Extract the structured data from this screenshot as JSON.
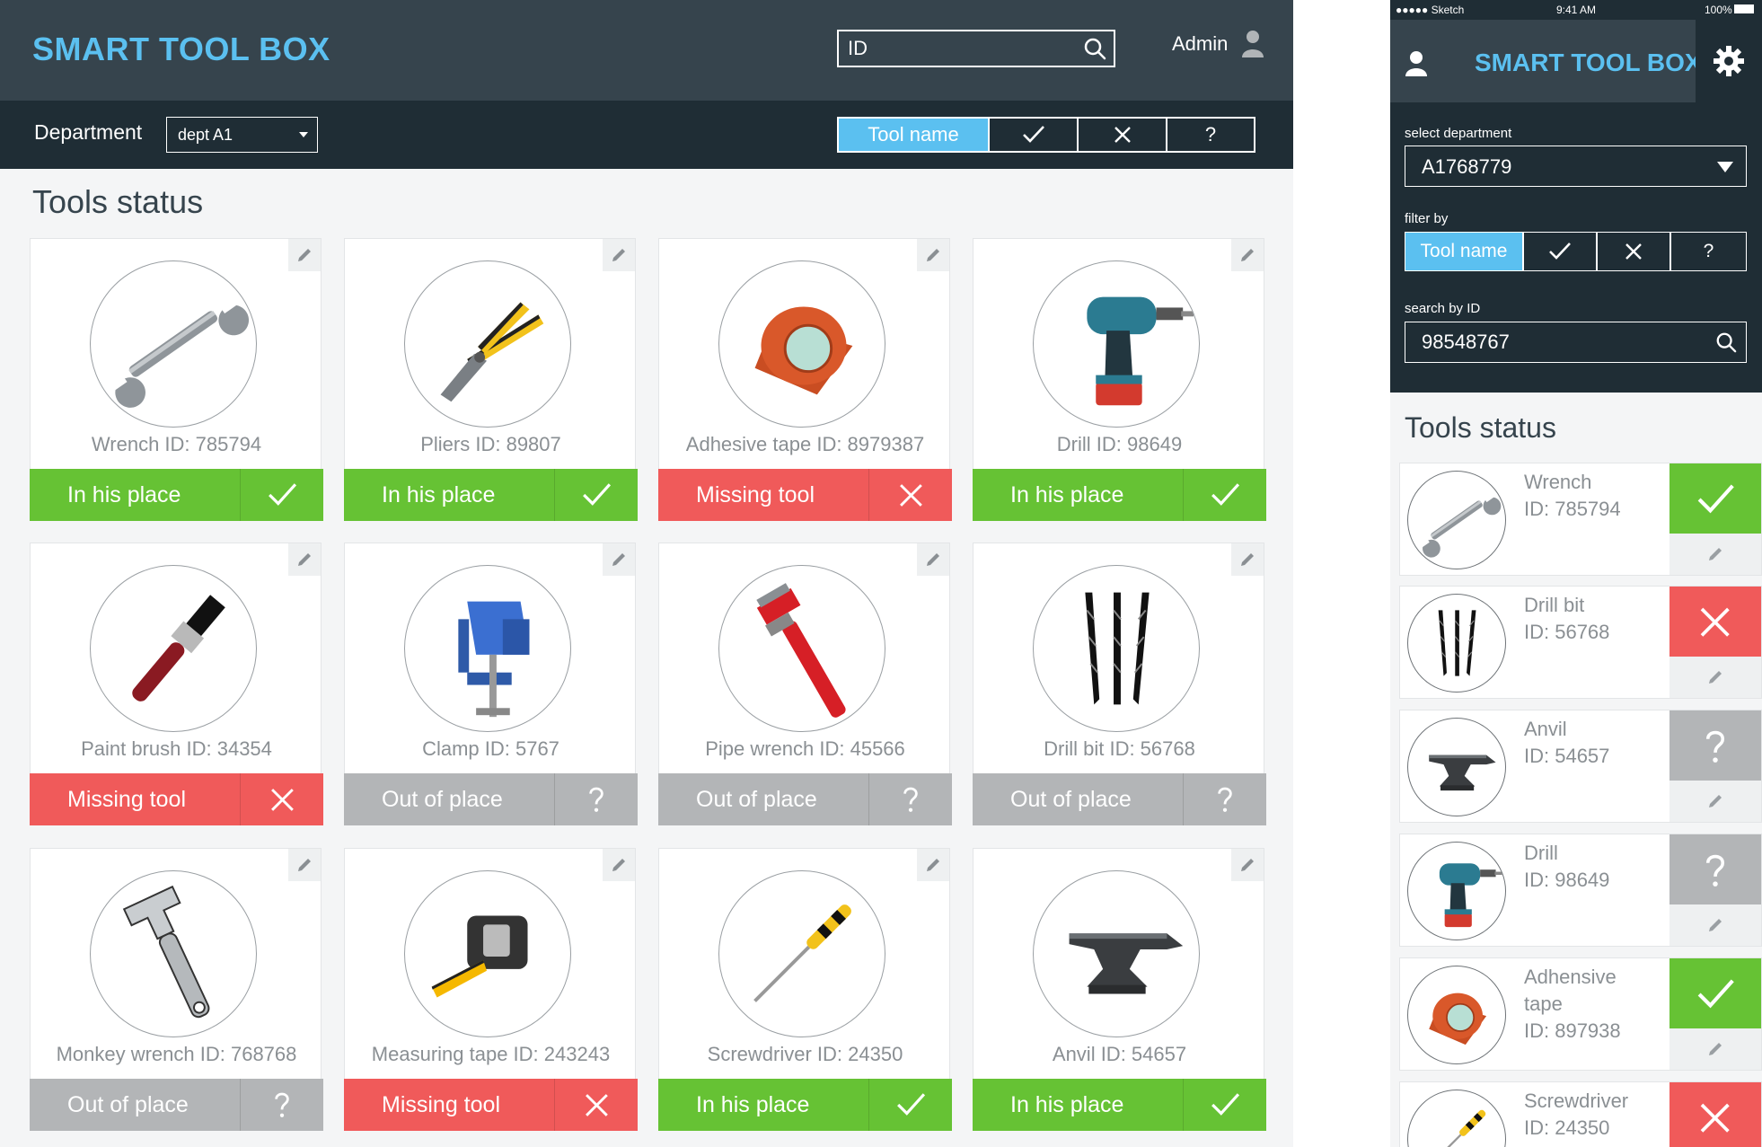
{
  "desktop": {
    "brand": "SMART TOOL BOX",
    "search_placeholder": "ID",
    "admin_label": "Admin",
    "department_label": "Department",
    "department_value": "dept A1",
    "filter": {
      "tool_name": "Tool name",
      "in_place_symbol": "✓",
      "missing_symbol": "✕",
      "out_symbol": "?"
    },
    "section_title": "Tools status",
    "tools": [
      {
        "name": "Wrench ID: 785794",
        "status": "In his place",
        "status_icon": "check-icon",
        "color": "#66c234"
      },
      {
        "name": "Pliers ID: 89807",
        "status": "In his place",
        "status_icon": "check-icon",
        "color": "#66c234"
      },
      {
        "name": "Adhesive tape ID: 8979387",
        "status": "Missing tool",
        "status_icon": "x-icon",
        "color": "#f05a5a"
      },
      {
        "name": "Drill ID: 98649",
        "status": "In his place",
        "status_icon": "check-icon",
        "color": "#66c234"
      },
      {
        "name": "Paint brush ID: 34354",
        "status": "Missing tool",
        "status_icon": "x-icon",
        "color": "#f05a5a"
      },
      {
        "name": "Clamp ID: 5767",
        "status": "Out of place",
        "status_icon": "question-icon",
        "color": "#b3b5b7"
      },
      {
        "name": "Pipe wrench ID: 45566",
        "status": "Out of place",
        "status_icon": "question-icon",
        "color": "#b3b5b7"
      },
      {
        "name": "Drill bit ID: 56768",
        "status": "Out of place",
        "status_icon": "question-icon",
        "color": "#b3b5b7"
      },
      {
        "name": "Monkey wrench ID: 768768",
        "status": "Out of place",
        "status_icon": "question-icon",
        "color": "#b3b5b7"
      },
      {
        "name": "Measuring tape ID: 243243",
        "status": "Missing tool",
        "status_icon": "x-icon",
        "color": "#f05a5a"
      },
      {
        "name": "Screwdriver ID: 24350",
        "status": "In his place",
        "status_icon": "check-icon",
        "color": "#66c234"
      },
      {
        "name": "Anvil ID: 54657",
        "status": "In his place",
        "status_icon": "check-icon",
        "color": "#66c234"
      }
    ]
  },
  "mobile": {
    "status_bar": {
      "carrier": "●●●●● Sketch",
      "time": "9:41 AM",
      "battery": "100%"
    },
    "brand": "SMART TOOL BOX",
    "select_department_label": "select department",
    "department_value": "A1768779",
    "filter_by_label": "filter by",
    "filter": {
      "tool_name": "Tool name",
      "in_place_symbol": "✓",
      "missing_symbol": "✕",
      "out_symbol": "?"
    },
    "search_label": "search by ID",
    "search_value": "98548767",
    "section_title": "Tools status",
    "tools": [
      {
        "name": "Wrench",
        "id": "ID: 785794",
        "status_icon": "check-icon",
        "color": "#66c234"
      },
      {
        "name": "Drill bit",
        "id": "ID: 56768",
        "status_icon": "x-icon",
        "color": "#f05a5a"
      },
      {
        "name": "Anvil",
        "id": "ID: 54657",
        "status_icon": "question-icon",
        "color": "#b3b5b7"
      },
      {
        "name": "Drill",
        "id": "ID: 98649",
        "status_icon": "question-icon",
        "color": "#b3b5b7"
      },
      {
        "name": "Adhensive tape",
        "id": "ID: 897938",
        "status_icon": "check-icon",
        "color": "#66c234"
      },
      {
        "name": "Screwdriver",
        "id": "ID: 24350",
        "status_icon": "x-icon",
        "color": "#f05a5a"
      }
    ]
  },
  "colors": {
    "accent": "#5bc0f0",
    "ok": "#66c234",
    "missing": "#f05a5a",
    "out": "#b3b5b7"
  }
}
